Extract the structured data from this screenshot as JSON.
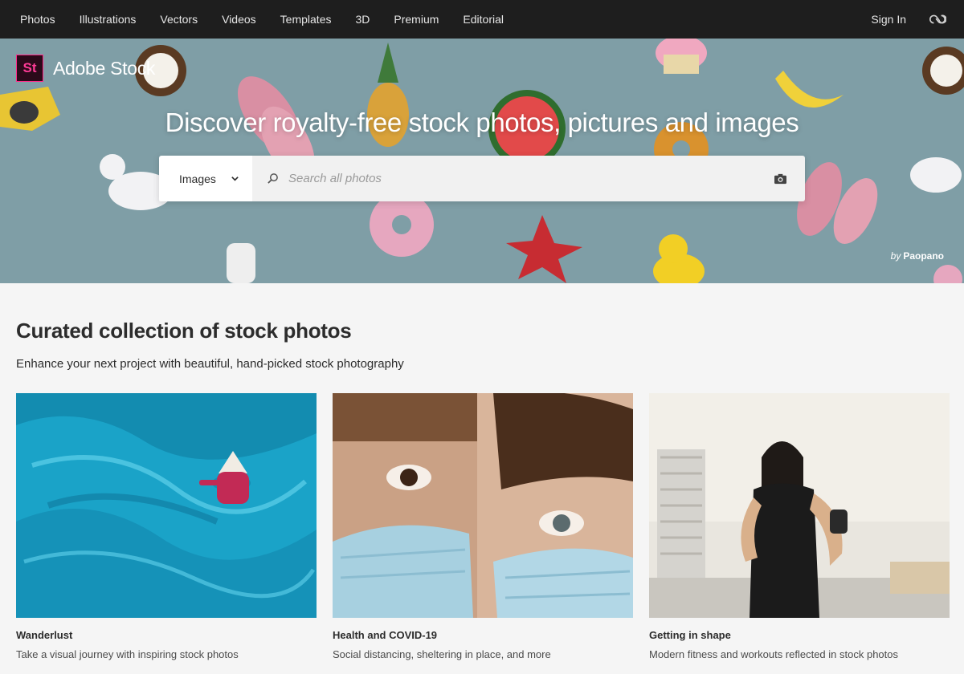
{
  "nav": {
    "links": [
      "Photos",
      "Illustrations",
      "Vectors",
      "Videos",
      "Templates",
      "3D",
      "Premium",
      "Editorial"
    ],
    "signin": "Sign In"
  },
  "brand": {
    "logo_text": "St",
    "name": "Adobe Stock",
    "accent": "#ff2b8a"
  },
  "hero": {
    "title": "Discover royalty-free stock photos, pictures and images",
    "search": {
      "type_selected": "Images",
      "placeholder": "Search all photos"
    },
    "credit_prefix": "by",
    "credit_name": "Paopano"
  },
  "section": {
    "title": "Curated collection of stock photos",
    "subtitle": "Enhance your next project with beautiful, hand-picked stock photography"
  },
  "cards": [
    {
      "title": "Wanderlust",
      "desc": "Take a visual journey with inspiring stock photos"
    },
    {
      "title": "Health and COVID-19",
      "desc": "Social distancing, sheltering in place, and more"
    },
    {
      "title": "Getting in shape",
      "desc": "Modern fitness and workouts reflected in stock photos"
    }
  ]
}
